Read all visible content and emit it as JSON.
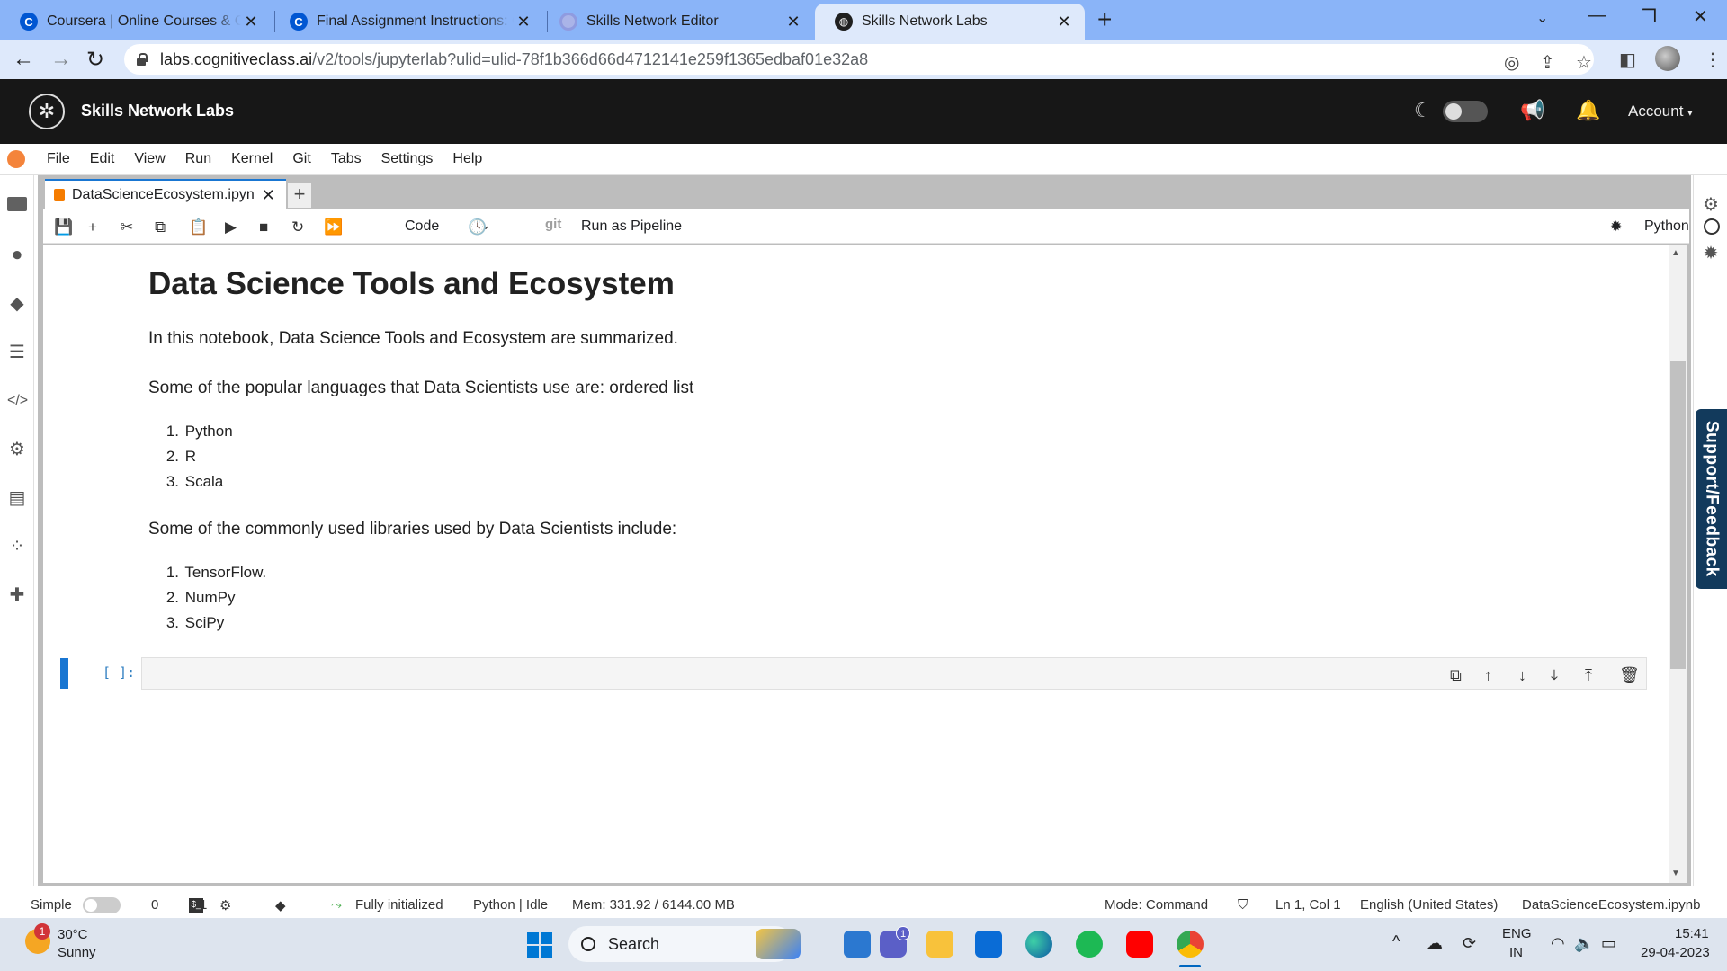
{
  "browser": {
    "tabs": [
      {
        "label": "Coursera | Online Courses & Credentials",
        "icon": "coursera-icon"
      },
      {
        "label": "Final Assignment Instructions: Create",
        "icon": "coursera-icon"
      },
      {
        "label": "Skills Network Editor",
        "icon": "skills-network-editor-icon"
      },
      {
        "label": "Skills Network Labs",
        "icon": "globe-icon",
        "active": true
      }
    ],
    "url_domain": "labs.cognitiveclass.ai",
    "url_path": "/v2/tools/jupyterlab?ulid=ulid-78f1b366d66d4712141e259f1365edbaf01e32a8"
  },
  "site_header": {
    "title": "Skills Network Labs",
    "account_label": "Account"
  },
  "menu": [
    "File",
    "Edit",
    "View",
    "Run",
    "Kernel",
    "Git",
    "Tabs",
    "Settings",
    "Help"
  ],
  "doc_tab": {
    "label": "DataScienceEcosystem.ipyn"
  },
  "notebook_toolbar": {
    "cell_type": "Code",
    "git_label": "git",
    "pipeline_label": "Run as Pipeline",
    "kernel": "Python"
  },
  "notebook": {
    "title": "Data Science Tools and Ecosystem",
    "intro": "In this notebook, Data Science Tools and Ecosystem are summarized.",
    "languages_intro": "Some of the popular languages that Data Scientists use are: ordered list",
    "languages": [
      "Python",
      "R",
      "Scala"
    ],
    "libraries_intro": "Some of the commonly used libraries used by Data Scientists include:",
    "libraries": [
      "TensorFlow.",
      "NumPy",
      "SciPy"
    ],
    "empty_cell_prompt": "[ ]:"
  },
  "support_label": "Support/Feedback",
  "status_bar": {
    "simple_label": "Simple",
    "count_0": "0",
    "count_1": "1",
    "init_status": "Fully initialized",
    "kernel_status": "Python | Idle",
    "memory": "Mem: 331.92 / 6144.00 MB",
    "mode": "Mode: Command",
    "cursor": "Ln 1, Col 1",
    "language": "English (United States)",
    "filename": "DataScienceEcosystem.ipynb"
  },
  "taskbar": {
    "weather_badge": "1",
    "temperature": "30°C",
    "weather": "Sunny",
    "search_label": "Search",
    "chat_badge": "1",
    "lang_line1": "ENG",
    "lang_line2": "IN",
    "time": "15:41",
    "date": "29-04-2023"
  },
  "colors": {
    "tab_strip": "#8ab4f8",
    "header_bg": "#171717",
    "active_cell": "#1976d2",
    "support_bg": "#123a5c"
  }
}
